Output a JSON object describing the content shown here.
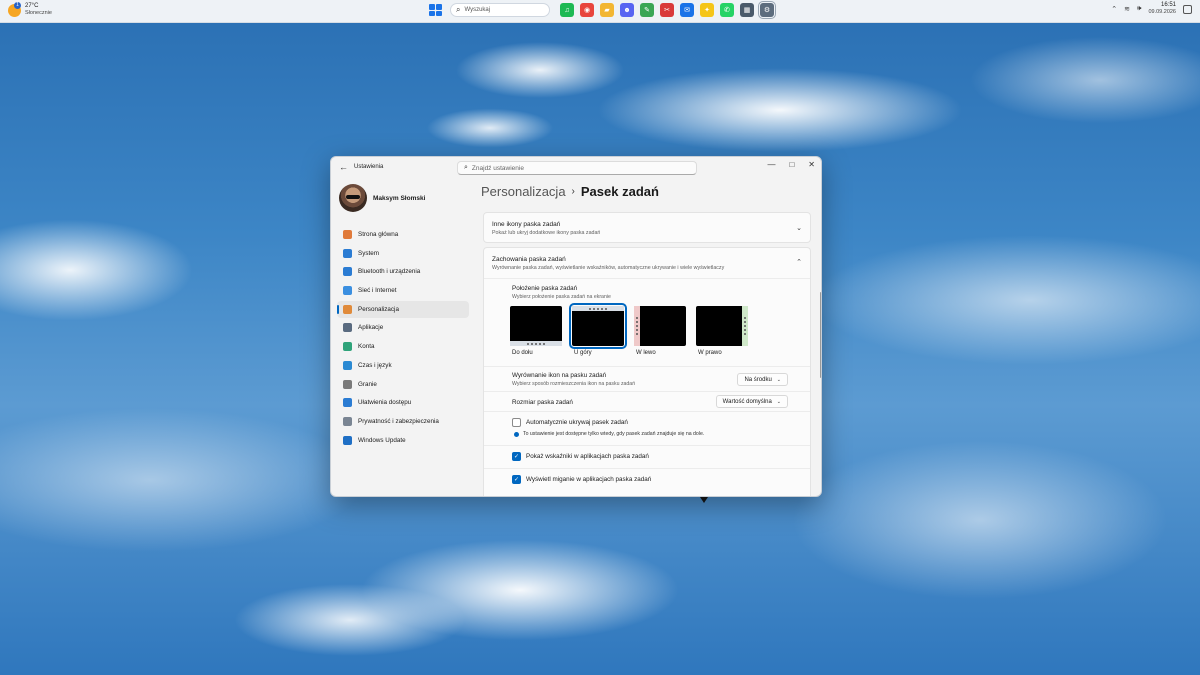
{
  "taskbar": {
    "weather": {
      "temp": "27°C",
      "condition": "Słonecznie",
      "badge": "1"
    },
    "search_placeholder": "Wyszukaj",
    "apps": [
      {
        "name": "spotify-icon",
        "color": "#1db954",
        "glyph": "♫"
      },
      {
        "name": "chrome-icon",
        "color": "#e8453c",
        "glyph": "◉"
      },
      {
        "name": "file-explorer-icon",
        "color": "#f2b632",
        "glyph": "▰"
      },
      {
        "name": "discord-icon",
        "color": "#5865f2",
        "glyph": "☻"
      },
      {
        "name": "paint-icon",
        "color": "#3aa655",
        "glyph": "✎"
      },
      {
        "name": "snipping-tool-icon",
        "color": "#d93a3a",
        "glyph": "✂"
      },
      {
        "name": "outlook-icon",
        "color": "#1a73e8",
        "glyph": "✉"
      },
      {
        "name": "tips-icon",
        "color": "#f5c518",
        "glyph": "✦"
      },
      {
        "name": "whatsapp-icon",
        "color": "#25d366",
        "glyph": "✆"
      },
      {
        "name": "calculator-icon",
        "color": "#4a5a6a",
        "glyph": "▦"
      },
      {
        "name": "settings-app-icon",
        "color": "#5d6d7e",
        "glyph": "⚙"
      }
    ],
    "clock": {
      "time": "16:51",
      "date": "09.09.2026"
    }
  },
  "window": {
    "title": "Ustawienia",
    "search_placeholder": "Znajdź ustawienie",
    "user_name": "Maksym Słomski",
    "nav": [
      {
        "label": "Strona główna",
        "icon": "home-icon",
        "color": "#e07a3a"
      },
      {
        "label": "System",
        "icon": "system-icon",
        "color": "#2b7cd3"
      },
      {
        "label": "Bluetooth i urządzenia",
        "icon": "bluetooth-icon",
        "color": "#2b7cd3"
      },
      {
        "label": "Sieć i Internet",
        "icon": "network-icon",
        "color": "#3b8fe0"
      },
      {
        "label": "Personalizacja",
        "icon": "brush-icon",
        "color": "#e08a3a"
      },
      {
        "label": "Aplikacje",
        "icon": "apps-icon",
        "color": "#5a6b80"
      },
      {
        "label": "Konta",
        "icon": "account-icon",
        "color": "#2fa37a"
      },
      {
        "label": "Czas i język",
        "icon": "clock-icon",
        "color": "#2b8ad3"
      },
      {
        "label": "Granie",
        "icon": "gamepad-icon",
        "color": "#7a7a7a"
      },
      {
        "label": "Ułatwienia dostępu",
        "icon": "accessibility-icon",
        "color": "#2b7cd3"
      },
      {
        "label": "Prywatność i zabezpieczenia",
        "icon": "shield-icon",
        "color": "#7a8593"
      },
      {
        "label": "Windows Update",
        "icon": "update-icon",
        "color": "#1f6fc5"
      }
    ],
    "selected_nav_index": 4,
    "breadcrumb": {
      "parent": "Personalizacja",
      "current": "Pasek zadań"
    },
    "other_icons": {
      "title": "Inne ikony paska zadań",
      "subtitle": "Pokaż lub ukryj dodatkowe ikony paska zadań"
    },
    "behaviors": {
      "title": "Zachowania paska zadań",
      "subtitle": "Wyrównanie paska zadań, wyświetlanie wskaźników, automatyczne ukrywanie i wiele wyświetlaczy",
      "position": {
        "title": "Położenie paska zadań",
        "subtitle": "Wybierz położenie paska zadań na ekranie",
        "options": [
          "Do dołu",
          "U góry",
          "W lewo",
          "W prawo"
        ],
        "selected": "U góry"
      },
      "alignment": {
        "title": "Wyrównanie ikon na pasku zadań",
        "subtitle": "Wybierz sposób rozmieszczenia ikon na pasku zadań",
        "value": "Na środku"
      },
      "size": {
        "title": "Rozmiar paska zadań",
        "value": "Wartość domyślna"
      },
      "auto_hide": {
        "label": "Automatycznie ukrywaj pasek zadań",
        "checked": false,
        "info": "To ustawienie jest dostępne tylko wtedy, gdy pasek zadań znajduje się na dole."
      },
      "badges": {
        "label": "Pokaż wskaźniki w aplikacjach paska zadań",
        "checked": true
      },
      "flashing": {
        "label": "Wyświetl miganie w aplikacjach paska zadań",
        "checked": true
      }
    }
  }
}
